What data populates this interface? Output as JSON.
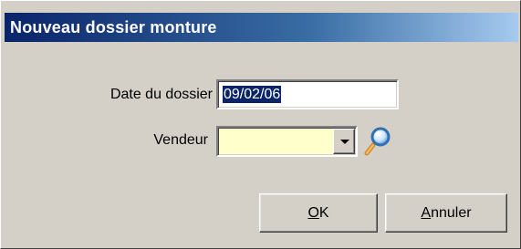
{
  "window": {
    "title": "Nouveau dossier monture"
  },
  "form": {
    "date_label": "Date du dossier",
    "date_value": "09/02/06",
    "vendeur_label": "Vendeur",
    "vendeur_value": ""
  },
  "buttons": {
    "ok_mnemonic": "O",
    "ok_rest": "K",
    "cancel_mnemonic": "A",
    "cancel_rest": "nnuler"
  },
  "icons": {
    "vendeur_lookup": "magnifier-icon",
    "dropdown": "chevron-down-icon"
  },
  "colors": {
    "title_bar_start": "#0a246a",
    "title_bar_end": "#a6caf0",
    "dialog_bg": "#d4d0c8",
    "combo_bg": "#ffffcc",
    "selection_bg": "#0a246a"
  }
}
